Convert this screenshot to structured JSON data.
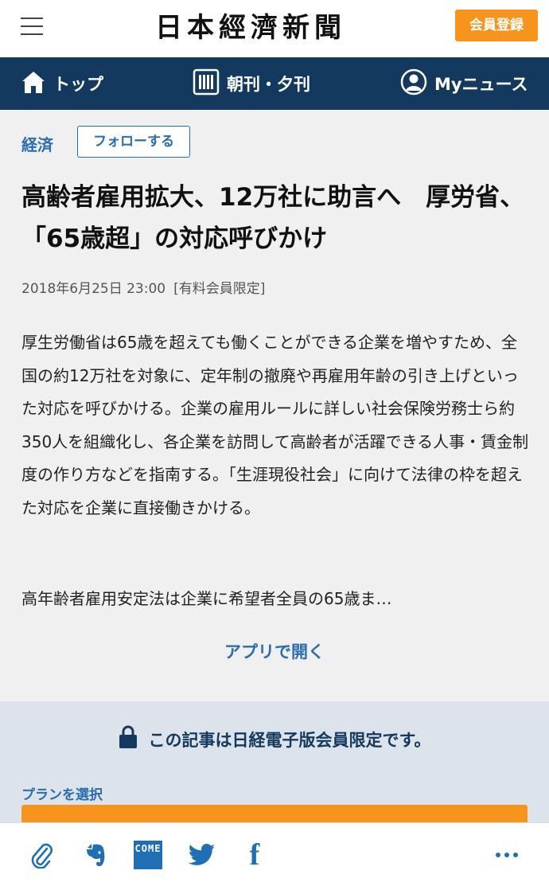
{
  "header": {
    "logo_text": "日本經濟新聞",
    "register_label": "会員登録"
  },
  "nav": {
    "top_label": "トップ",
    "paper_label": "朝刊・夕刊",
    "my_label": "Myニュース"
  },
  "article": {
    "category": "経済",
    "follow_label": "フォローする",
    "headline": "高齢者雇用拡大、12万社に助言へ　厚労省、「65歳超」の対応呼びかけ",
    "date": "2018年6月25日 23:00",
    "badge": "[有料会員限定]",
    "paragraph1": "厚生労働省は65歳を超えても働くことができる企業を増やすため、全国の約12万社を対象に、定年制の撤廃や再雇用年齢の引き上げといった対応を呼びかける。企業の雇用ルールに詳しい社会保険労務士ら約350人を組織化し、各企業を訪問して高齢者が活躍できる人事・賃金制度の作り方などを指南する。「生涯現役社会」に向けて法律の枠を超えた対応を企業に直接働きかける。",
    "paragraph2": "高年齢者雇用安定法は企業に希望者全員の65歳ま…",
    "open_app_label": "アプリで開く"
  },
  "paywall": {
    "message": "この記事は日経電子版会員限定です。",
    "plan_label": "プランを選択"
  },
  "share": {
    "icons": [
      "paperclip-icon",
      "evernote-icon",
      "come-icon",
      "twitter-icon",
      "facebook-icon",
      "more-icon"
    ],
    "come_text": "COME",
    "facebook_text": "f"
  },
  "colors": {
    "nav_bg": "#13395e",
    "accent_orange": "#f7941d",
    "link_blue": "#2a6db0",
    "paywall_bg": "#dce3ea"
  }
}
